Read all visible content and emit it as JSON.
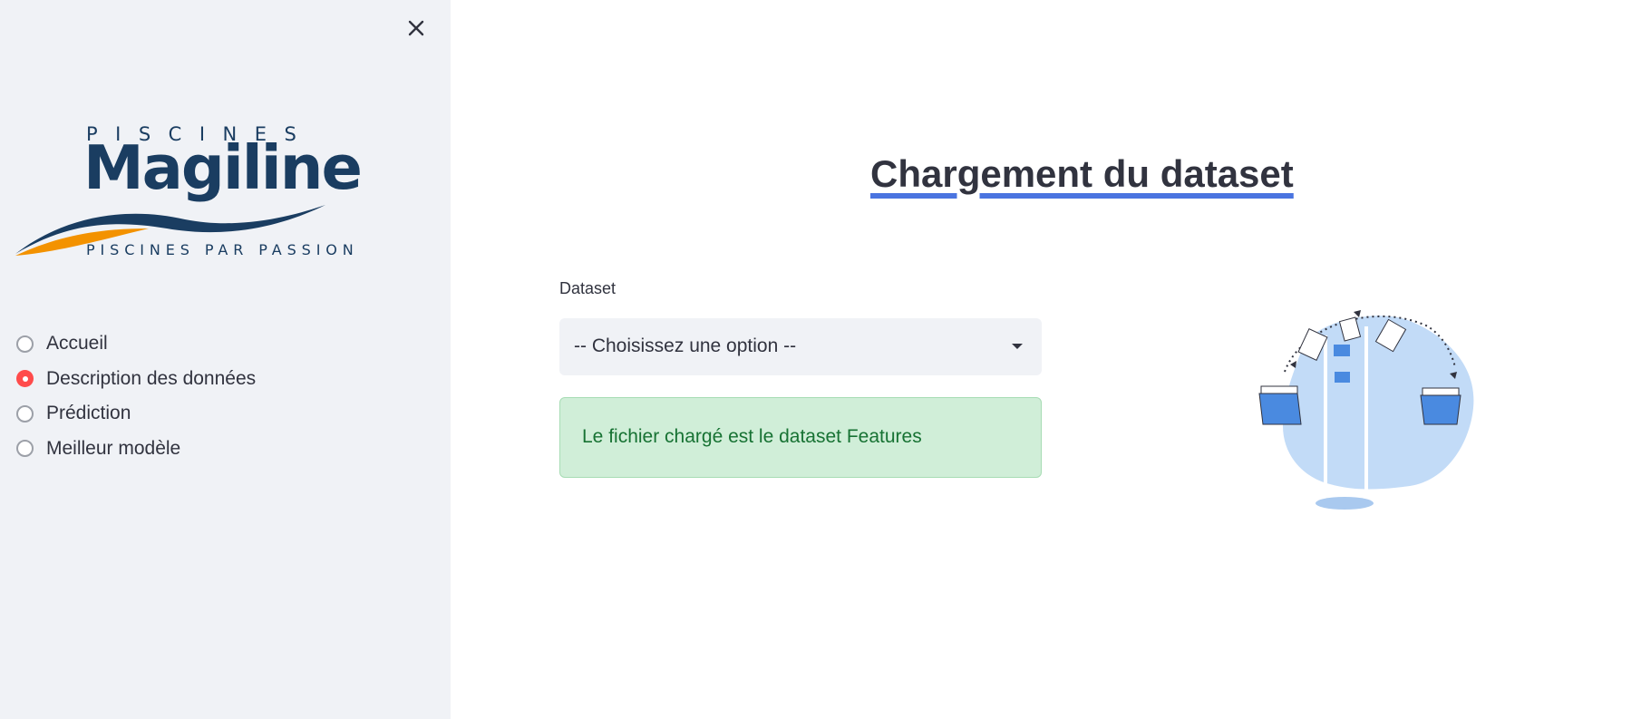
{
  "sidebar": {
    "close_icon": "close-icon",
    "logo": {
      "top_text": "PISCINES",
      "brand": "Magiline",
      "tagline": "PISCINES PAR PASSION",
      "colors": {
        "navy": "#1a3d61",
        "orange": "#f39200"
      }
    },
    "nav": [
      {
        "label": "Accueil",
        "selected": false
      },
      {
        "label": "Description des données",
        "selected": true
      },
      {
        "label": "Prédiction",
        "selected": false
      },
      {
        "label": "Meilleur modèle",
        "selected": false
      }
    ]
  },
  "main": {
    "title": "Chargement du dataset",
    "dataset_label": "Dataset",
    "select_value": "-- Choisissez une option --",
    "success_message": "Le fichier chargé est le dataset Features",
    "illustration_icon": "file-transfer-illustration"
  },
  "colors": {
    "accent": "#ff4b4b",
    "title_underline": "#4a74e0",
    "success_bg": "#d0eed8",
    "success_text": "#177233",
    "sidebar_bg": "#f0f2f6"
  }
}
